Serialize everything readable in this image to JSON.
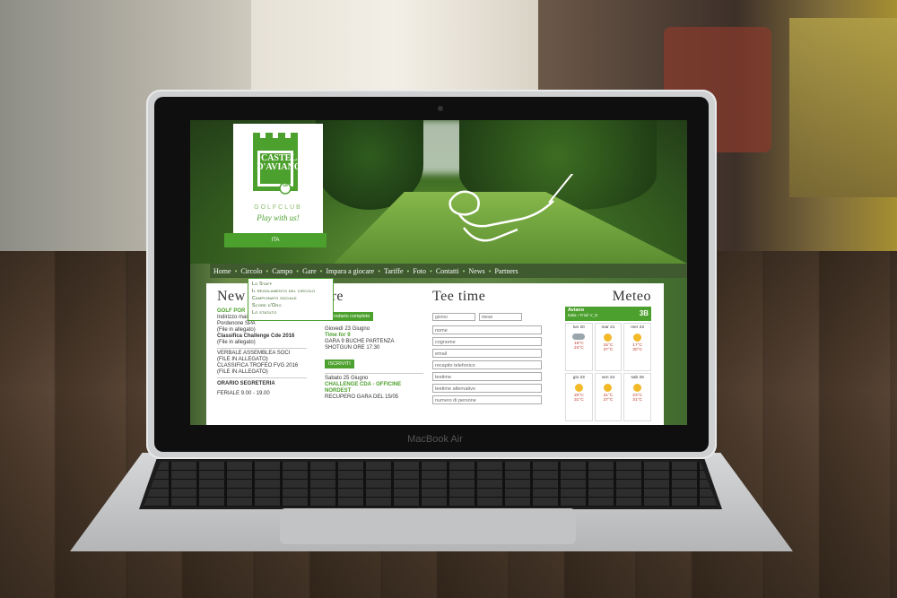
{
  "device": {
    "brand_label": "MacBook Air"
  },
  "site": {
    "logo": {
      "line1": "CASTEL",
      "line2": "D'AVIANO",
      "line3": "GOLFCLUB",
      "badge": "18",
      "slogan": "Play with us!"
    },
    "language": "ITA",
    "nav": [
      "Home",
      "Circolo",
      "Campo",
      "Gare",
      "Impara a giocare",
      "Tariffe",
      "Foto",
      "Contatti",
      "News",
      "Partners"
    ],
    "dropdown": [
      "Lo Staff",
      "Il regolamento del circolo",
      "Campionato sociale",
      "Score d'Oro",
      "Lo statuto"
    ],
    "news": {
      "title": "New",
      "items": [
        {
          "green": "GOLF POR",
          "text": ""
        },
        {
          "text": "Indirizzo mail per domande a Golf"
        },
        {
          "text": "Pordenone SPA"
        },
        {
          "text": "(File in allegato)"
        },
        {
          "bold": "Classifica Challenge Cde 2016"
        },
        {
          "text": "(File in allegato)"
        }
      ],
      "items2": [
        "VERBALE ASSEMBLEA SOCI",
        "(FILE IN ALLEGATO)",
        "CLASSIFICA TROFEO FVG 2016",
        "(FILE IN ALLEGATO)"
      ],
      "segreteria_title": "ORARIO SEGRETERIA",
      "segreteria_line": "FERIALE 9.00 - 19.00"
    },
    "gare": {
      "title": "are",
      "calendar_button": "alendario completo",
      "event1": {
        "date": "Giovedì 23 Giugno",
        "name": "Time for 9",
        "desc1": "GARA 9 BUCHE PARTENZA",
        "desc2": "SHOTGUN ORE 17:30",
        "button": "ISCRIVITI"
      },
      "event2": {
        "date": "Sabato 25 Giugno",
        "name1": "CHALLENGE CDA - OFFICINE",
        "name2": "NORDEST",
        "desc": "RECUPERO GARA DEL 15/05"
      }
    },
    "teetime": {
      "title": "Tee time",
      "day_select": "giorno",
      "month_select": "mese",
      "fields": [
        "nome",
        "cognome",
        "email",
        "recapito telefonico",
        "teetime",
        "teetime alternativo",
        "numero di persone"
      ]
    },
    "meteo": {
      "title": "Meteo",
      "location": "Aviano",
      "region1": "Italia",
      "region2": "Friuli V_G",
      "logo": "3B",
      "days": [
        {
          "day": "lun 20",
          "tmin": "19°C",
          "tmax": "24°C",
          "icon": "cloud"
        },
        {
          "day": "mar 21",
          "tmin": "15°C",
          "tmax": "27°C",
          "icon": "sun"
        },
        {
          "day": "mer 22",
          "tmin": "17°C",
          "tmax": "30°C",
          "icon": "sun"
        },
        {
          "day": "gio 23",
          "tmin": "20°C",
          "tmax": "31°C",
          "icon": "sun"
        },
        {
          "day": "ven 24",
          "tmin": "21°C",
          "tmax": "27°C",
          "icon": "sun"
        },
        {
          "day": "sab 25",
          "tmin": "23°C",
          "tmax": "31°C",
          "icon": "sun"
        }
      ]
    },
    "colors": {
      "brand_green": "#4ca02d",
      "nav_bg": "#3e5a2e"
    }
  }
}
